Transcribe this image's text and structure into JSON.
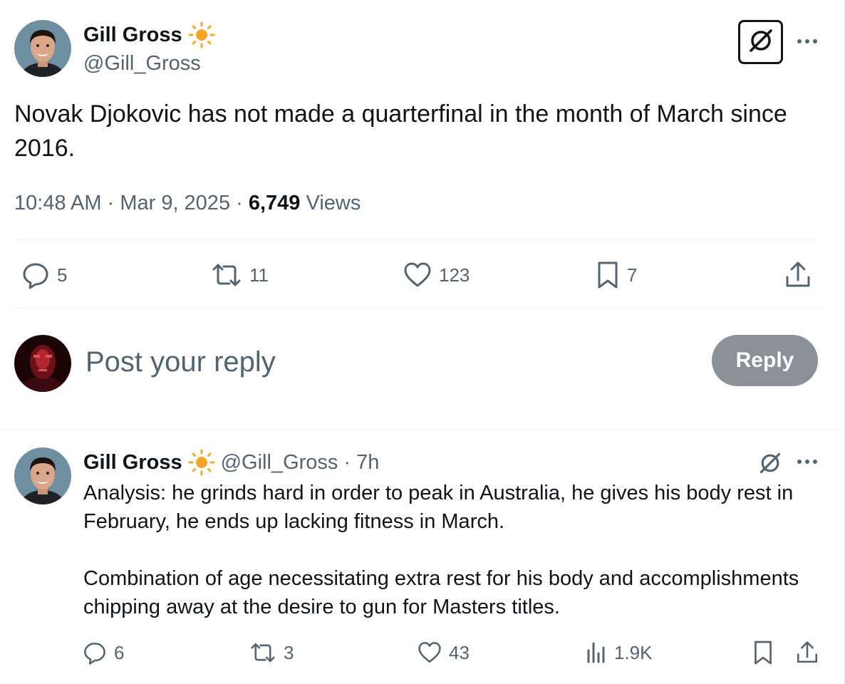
{
  "main_tweet": {
    "author_name": "Gill Gross",
    "author_handle": "@Gill_Gross",
    "text": "Novak Djokovic has not made a quarterfinal in the month of March since 2016.",
    "time": "10:48 AM",
    "sep1": " · ",
    "date": "Mar 9, 2025",
    "sep2": " · ",
    "views_count": "6,749",
    "views_label": " Views",
    "stats": {
      "replies": "5",
      "reposts": "11",
      "likes": "123",
      "bookmarks": "7"
    }
  },
  "reply_composer": {
    "placeholder": "Post your reply",
    "button_label": "Reply"
  },
  "reply_tweet": {
    "author_name": "Gill Gross",
    "author_handle": "@Gill_Gross",
    "separator": " · ",
    "time_ago": "7h",
    "paragraph_1": "Analysis: he grinds hard in order to peak in Australia, he gives his body rest in February, he ends up lacking fitness in March.",
    "paragraph_2": "Combination of age necessitating extra rest for his body and accomplishments chipping away at the desire to gun for Masters titles.",
    "stats": {
      "replies": "6",
      "reposts": "3",
      "likes": "43",
      "views": "1.9K"
    }
  },
  "icons": {
    "badge": "sun-icon",
    "grok": "grok-icon",
    "more": "more-icon",
    "reply": "comment-icon",
    "repost": "repost-icon",
    "like": "heart-icon",
    "bookmark": "bookmark-icon",
    "share": "share-icon",
    "views": "analytics-icon"
  },
  "colors": {
    "text": "#0f1419",
    "secondary": "#536471",
    "divider": "#eff3f4",
    "reply_button": "#8b9196",
    "badge": "#f5a623"
  }
}
